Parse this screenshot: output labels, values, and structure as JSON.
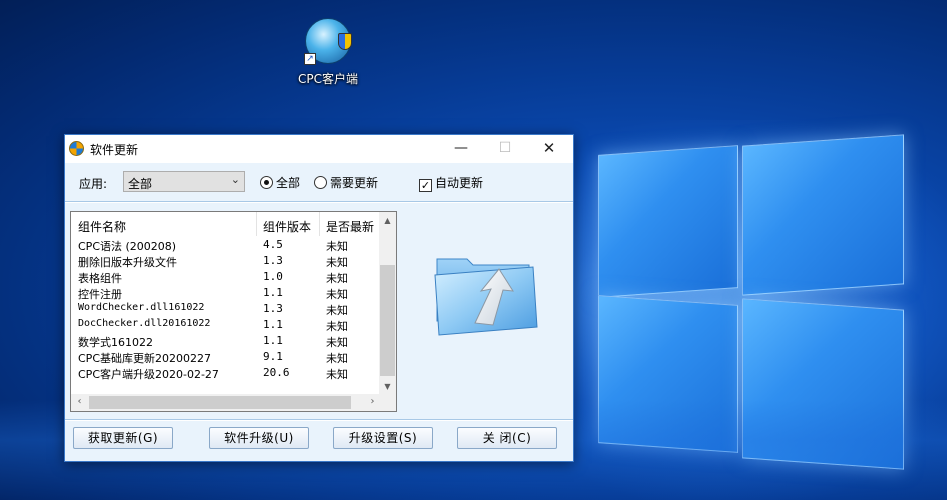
{
  "desktop": {
    "icon_label": "CPC客户端"
  },
  "window": {
    "title": "软件更新",
    "controls": {
      "minimize": "—",
      "maximize": "☐",
      "close": "✕"
    }
  },
  "filter": {
    "app_label": "应用:",
    "app_selected": "全部",
    "radio_all": "全部",
    "radio_all_checked": true,
    "radio_need_update": "需要更新",
    "radio_need_update_checked": false,
    "auto_update_label": "自动更新",
    "auto_update_checked": true
  },
  "list": {
    "columns": [
      "组件名称",
      "组件版本",
      "是否最新"
    ],
    "rows": [
      {
        "name": "CPC语法 (200208)",
        "version": "4.5",
        "status": "未知"
      },
      {
        "name": "删除旧版本升级文件",
        "version": "1.3",
        "status": "未知"
      },
      {
        "name": "表格组件",
        "version": "1.0",
        "status": "未知"
      },
      {
        "name": "控件注册",
        "version": "1.1",
        "status": "未知"
      },
      {
        "name": "WordChecker.dll161022",
        "version": "1.3",
        "status": "未知"
      },
      {
        "name": "DocChecker.dll20161022",
        "version": "1.1",
        "status": "未知"
      },
      {
        "name": "数学式161022",
        "version": "1.1",
        "status": "未知"
      },
      {
        "name": "CPC基础库更新20200227",
        "version": "9.1",
        "status": "未知"
      },
      {
        "name": "CPC客户端升级2020-02-27",
        "version": "20.6",
        "status": "未知"
      }
    ]
  },
  "buttons": {
    "fetch": "获取更新(G)",
    "upgrade": "软件升级(U)",
    "settings": "升级设置(S)",
    "close": "关 闭(C)"
  },
  "colors": {
    "accent": "#3a78c8",
    "client_bg": "#e9f3fc",
    "desktop_bg": "#0b4bb3"
  }
}
